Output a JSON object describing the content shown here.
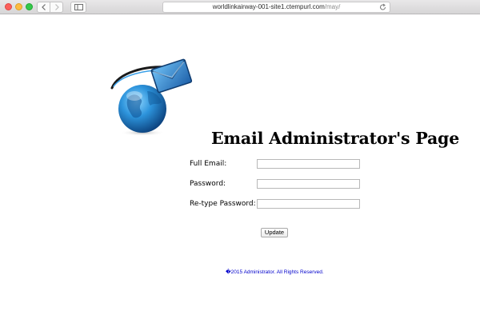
{
  "browser": {
    "url_host": "worldlinkairway-001-site1.ctempurl.com",
    "url_path": "/may/"
  },
  "page": {
    "title": "Email Administrator's Page",
    "logo_icon": "globe-envelope-icon"
  },
  "form": {
    "full_email_label": "Full Email:",
    "password_label": "Password:",
    "retype_password_label": "Re-type Password:",
    "full_email_value": "",
    "password_value": "",
    "retype_password_value": "",
    "update_label": "Update"
  },
  "footer": {
    "text": "�2015 Administrator. All Rights Reserved."
  },
  "colors": {
    "footer_link": "#0000cc",
    "globe_blue": "#1e88d8",
    "envelope_blue": "#2f7fc8"
  }
}
